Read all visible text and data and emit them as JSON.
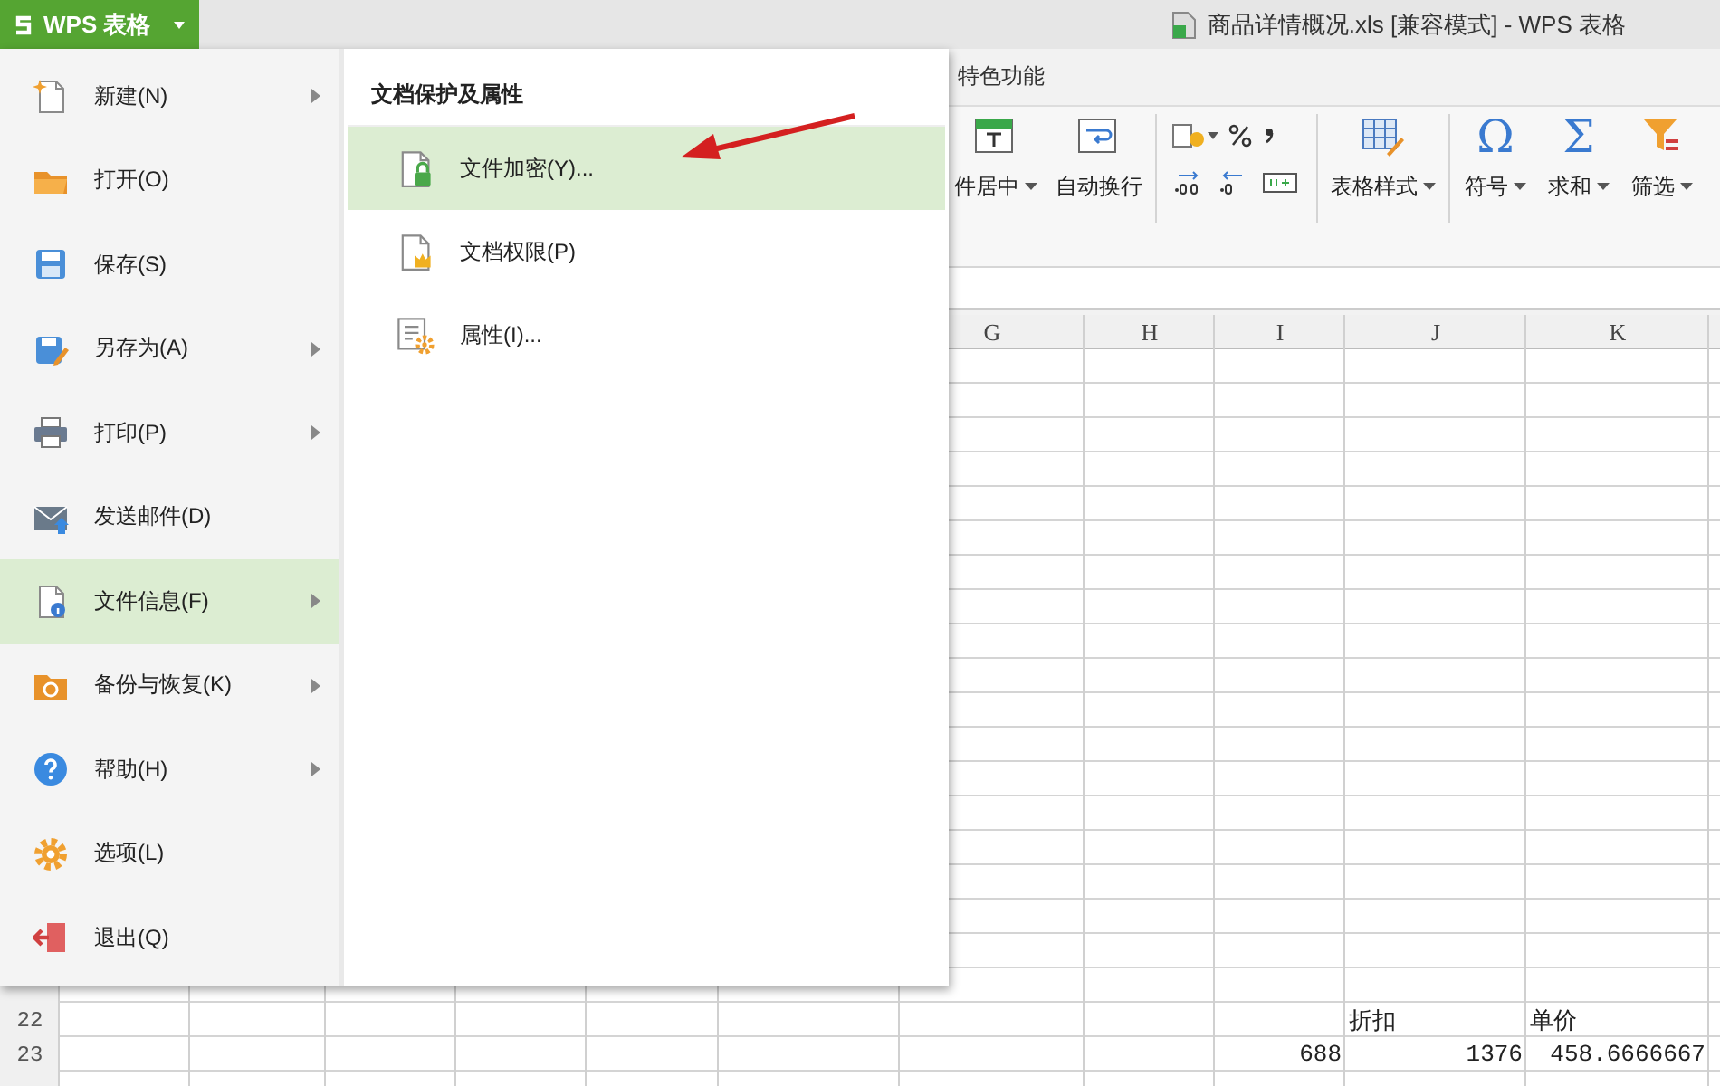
{
  "app_button": {
    "label": "WPS 表格"
  },
  "window": {
    "title": "商品详情概况.xls [兼容模式] - WPS 表格"
  },
  "tabs": [
    {
      "label": "特色功能"
    }
  ],
  "ribbon": [
    {
      "kind": "large",
      "label": "件居中",
      "dropdown": true
    },
    {
      "kind": "large",
      "label": "自动换行",
      "dropdown": false
    },
    {
      "kind": "number_group"
    },
    {
      "kind": "large",
      "label": "表格样式",
      "dropdown": true
    },
    {
      "kind": "large",
      "label": "符号",
      "glyph": "Ω",
      "dropdown": true
    },
    {
      "kind": "large",
      "label": "求和",
      "glyph": "Σ",
      "dropdown": true
    },
    {
      "kind": "large",
      "label": "筛选",
      "dropdown": true
    }
  ],
  "sheet": {
    "columns": [
      {
        "label": "G"
      },
      {
        "label": "H"
      },
      {
        "label": "I"
      },
      {
        "label": "J"
      },
      {
        "label": "K"
      }
    ],
    "rows": [
      {
        "number": "22",
        "column_j": {
          "text": "折扣",
          "kind": "text"
        },
        "column_k": {
          "text": "单价",
          "kind": "text"
        }
      },
      {
        "number": "23",
        "column_i": {
          "text": "688",
          "kind": "number"
        },
        "column_j": {
          "text": "1376",
          "kind": "number"
        },
        "column_k": {
          "text": "458.6666667",
          "kind": "number"
        }
      }
    ]
  },
  "file_menu": {
    "items": [
      {
        "label": "新建(N)",
        "submenu": true,
        "selected": false
      },
      {
        "label": "打开(O)",
        "submenu": false,
        "selected": false
      },
      {
        "label": "保存(S)",
        "submenu": false,
        "selected": false
      },
      {
        "label": "另存为(A)",
        "submenu": true,
        "selected": false
      },
      {
        "label": "打印(P)",
        "submenu": true,
        "selected": false
      },
      {
        "label": "发送邮件(D)",
        "submenu": false,
        "selected": false
      },
      {
        "label": "文件信息(F)",
        "submenu": true,
        "selected": true
      },
      {
        "label": "备份与恢复(K)",
        "submenu": true,
        "selected": false
      },
      {
        "label": "帮助(H)",
        "submenu": true,
        "selected": false
      },
      {
        "label": "选项(L)",
        "submenu": false,
        "selected": false
      },
      {
        "label": "退出(Q)",
        "submenu": false,
        "selected": false
      }
    ],
    "submenu": {
      "title": "文档保护及属性",
      "items": [
        {
          "label": "文件加密(Y)...",
          "selected": true
        },
        {
          "label": "文档权限(P)",
          "selected": false
        },
        {
          "label": "属性(I)...",
          "selected": false
        }
      ]
    }
  }
}
